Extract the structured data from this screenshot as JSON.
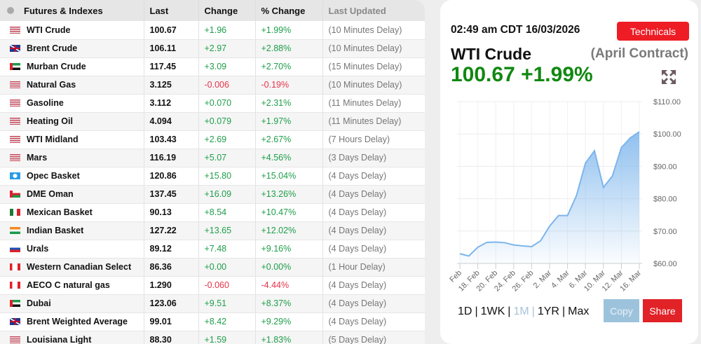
{
  "table": {
    "headers": [
      "Futures & Indexes",
      "Last",
      "Change",
      "% Change",
      "Last Updated"
    ],
    "rows": [
      {
        "flag": "us",
        "name": "WTI Crude",
        "last": "100.67",
        "change": "+1.96",
        "pct": "+1.99%",
        "updated": "(10 Minutes Delay)"
      },
      {
        "flag": "uk",
        "name": "Brent Crude",
        "last": "106.11",
        "change": "+2.97",
        "pct": "+2.88%",
        "updated": "(10 Minutes Delay)"
      },
      {
        "flag": "ae",
        "name": "Murban Crude",
        "last": "117.45",
        "change": "+3.09",
        "pct": "+2.70%",
        "updated": "(15 Minutes Delay)"
      },
      {
        "flag": "us",
        "name": "Natural Gas",
        "last": "3.125",
        "change": "-0.006",
        "pct": "-0.19%",
        "updated": "(10 Minutes Delay)"
      },
      {
        "flag": "us",
        "name": "Gasoline",
        "last": "3.112",
        "change": "+0.070",
        "pct": "+2.31%",
        "updated": "(11 Minutes Delay)"
      },
      {
        "flag": "us",
        "name": "Heating Oil",
        "last": "4.094",
        "change": "+0.079",
        "pct": "+1.97%",
        "updated": "(11 Minutes Delay)"
      },
      {
        "flag": "us",
        "name": "WTI Midland",
        "last": "103.43",
        "change": "+2.69",
        "pct": "+2.67%",
        "updated": "(7 Hours Delay)"
      },
      {
        "flag": "us",
        "name": "Mars",
        "last": "116.19",
        "change": "+5.07",
        "pct": "+4.56%",
        "updated": "(3 Days Delay)"
      },
      {
        "flag": "opec",
        "name": "Opec Basket",
        "last": "120.86",
        "change": "+15.80",
        "pct": "+15.04%",
        "updated": "(4 Days Delay)"
      },
      {
        "flag": "om",
        "name": "DME Oman",
        "last": "137.45",
        "change": "+16.09",
        "pct": "+13.26%",
        "updated": "(4 Days Delay)"
      },
      {
        "flag": "mx",
        "name": "Mexican Basket",
        "last": "90.13",
        "change": "+8.54",
        "pct": "+10.47%",
        "updated": "(4 Days Delay)"
      },
      {
        "flag": "in",
        "name": "Indian Basket",
        "last": "127.22",
        "change": "+13.65",
        "pct": "+12.02%",
        "updated": "(4 Days Delay)"
      },
      {
        "flag": "ru",
        "name": "Urals",
        "last": "89.12",
        "change": "+7.48",
        "pct": "+9.16%",
        "updated": "(4 Days Delay)"
      },
      {
        "flag": "ca",
        "name": "Western Canadian Select",
        "last": "86.36",
        "change": "+0.00",
        "pct": "+0.00%",
        "updated": "(1 Hour Delay)"
      },
      {
        "flag": "ca",
        "name": "AECO C natural gas",
        "last": "1.290",
        "change": "-0.060",
        "pct": "-4.44%",
        "updated": "(4 Days Delay)"
      },
      {
        "flag": "ae",
        "name": "Dubai",
        "last": "123.06",
        "change": "+9.51",
        "pct": "+8.37%",
        "updated": "(4 Days Delay)"
      },
      {
        "flag": "uk",
        "name": "Brent Weighted Average",
        "last": "99.01",
        "change": "+8.42",
        "pct": "+9.29%",
        "updated": "(4 Days Delay)"
      },
      {
        "flag": "us",
        "name": "Louisiana Light",
        "last": "88.30",
        "change": "+1.59",
        "pct": "+1.83%",
        "updated": "(5 Days Delay)"
      }
    ]
  },
  "panel": {
    "timestamp": "02:49 am CDT 16/03/2026",
    "technicals_label": "Technicals",
    "title": "WTI Crude",
    "contract": "(April Contract)",
    "price": "100.67 +1.99%",
    "ranges": [
      "1D",
      "1WK",
      "1M",
      "1YR",
      "Max"
    ],
    "selected_range": "1M",
    "copy_label": "Copy",
    "share_label": "Share"
  },
  "colors": {
    "positive": "#1e9e4a",
    "negative": "#e8334a",
    "accent": "#ee1c25",
    "line": "#7cb5ec"
  },
  "chart_data": {
    "type": "area",
    "x": [
      "16. Feb",
      "17. Feb",
      "18. Feb",
      "19. Feb",
      "20. Feb",
      "23. Feb",
      "24. Feb",
      "25. Feb",
      "26. Feb",
      "27. Feb",
      "2. Mar",
      "3. Mar",
      "4. Mar",
      "5. Mar",
      "6. Mar",
      "9. Mar",
      "10. Mar",
      "11. Mar",
      "12. Mar",
      "13. Mar",
      "16. Mar"
    ],
    "values": [
      63.0,
      62.3,
      65.0,
      66.5,
      66.6,
      66.4,
      65.7,
      65.4,
      65.2,
      67.0,
      71.5,
      74.8,
      74.8,
      81.0,
      91.0,
      94.8,
      83.5,
      87.0,
      95.8,
      98.8,
      100.67
    ],
    "tick_labels": [
      "Feb",
      "18. Feb",
      "20. Feb",
      "24. Feb",
      "26. Feb",
      "2. Mar",
      "4. Mar",
      "6. Mar",
      "10. Mar",
      "12. Mar",
      "16. Mar"
    ],
    "y_ticks": [
      "$60.00",
      "$70.00",
      "$80.00",
      "$90.00",
      "$100.00",
      "$110.00"
    ],
    "ylim": [
      60,
      110
    ],
    "grid": true
  }
}
